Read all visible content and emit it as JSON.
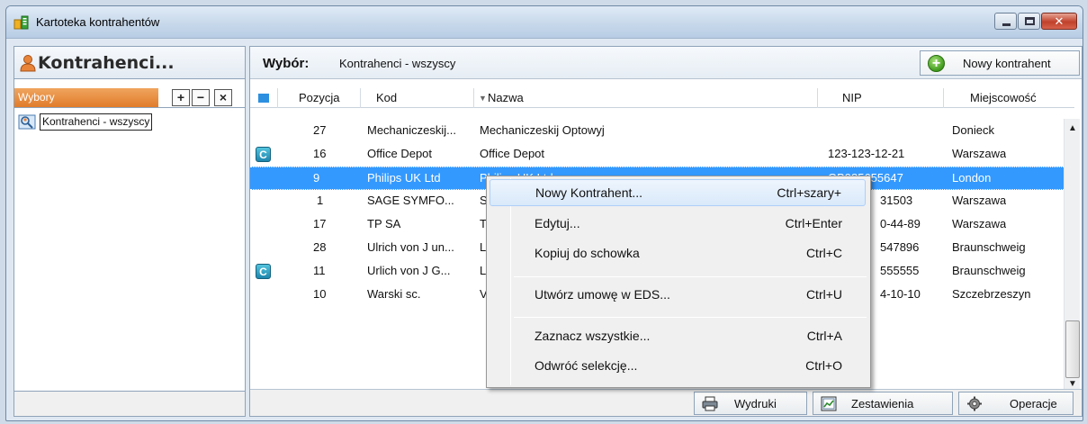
{
  "window": {
    "title": "Kartoteka kontrahentów"
  },
  "left_panel": {
    "title": "Kontrahenci...",
    "selections_label": "Wybory",
    "add_label": "+",
    "remove_label": "−",
    "close_label": "×",
    "tree_items": [
      {
        "label": "Kontrahenci - wszyscy"
      }
    ]
  },
  "right_panel": {
    "selection_label": "Wybór:",
    "selection_value": "Kontrahenci - wszyscy",
    "new_button_label": "Nowy kontrahent",
    "columns": {
      "pozycja": "Pozycja",
      "kod": "Kod",
      "nazwa": "Nazwa",
      "nazwa_sort": "▼",
      "nip": "NIP",
      "miejscowosc": "Miejscowość"
    },
    "rows": [
      {
        "icon": "",
        "pozycja": "27",
        "kod": "Mechaniczeskij...",
        "nazwa": "Mechaniczeskij Optowyj",
        "nip": "",
        "miejscowosc": "Donieck"
      },
      {
        "icon": "C",
        "pozycja": "16",
        "kod": "Office Depot",
        "nazwa": "Office Depot",
        "nip": "123-123-12-21",
        "miejscowosc": "Warszawa"
      },
      {
        "icon": "",
        "pozycja": "9",
        "kod": "Philips UK Ltd",
        "nazwa": "Philips UK Ltd",
        "nip": "GB985655647",
        "miejscowosc": "London"
      },
      {
        "icon": "",
        "pozycja": "1",
        "kod": "SAGE SYMFO...",
        "nazwa": "S",
        "nip": "31503",
        "miejscowosc": "Warszawa"
      },
      {
        "icon": "",
        "pozycja": "17",
        "kod": "TP SA",
        "nazwa": "T",
        "nip": "0-44-89",
        "miejscowosc": "Warszawa"
      },
      {
        "icon": "",
        "pozycja": "28",
        "kod": "Ulrich von J un...",
        "nazwa": "L",
        "nip": "547896",
        "miejscowosc": "Braunschweig"
      },
      {
        "icon": "C",
        "pozycja": "11",
        "kod": "Urlich von J G...",
        "nazwa": "L",
        "nip": "555555",
        "miejscowosc": "Braunschweig"
      },
      {
        "icon": "",
        "pozycja": "10",
        "kod": "Warski sc.",
        "nazwa": "V",
        "nip": "4-10-10",
        "miejscowosc": "Szczebrzeszyn"
      }
    ],
    "bottom_buttons": {
      "print": "Wydruki",
      "reports": "Zestawienia",
      "operations": "Operacje"
    }
  },
  "context_menu": {
    "items": [
      {
        "label": "Nowy Kontrahent...",
        "shortcut": "Ctrl+szary+"
      },
      {
        "label": "Edytuj...",
        "shortcut": "Ctrl+Enter"
      },
      {
        "label": "Kopiuj do schowka",
        "shortcut": "Ctrl+C"
      },
      {
        "label": "Utwórz umowę w EDS...",
        "shortcut": "Ctrl+U"
      },
      {
        "label": "Zaznacz wszystkie...",
        "shortcut": "Ctrl+A"
      },
      {
        "label": "Odwróć selekcję...",
        "shortcut": "Ctrl+O"
      }
    ]
  },
  "colors": {
    "selection": "#3399ff",
    "selections_tab": "#e07b2a",
    "badge": "#1e86ad",
    "add_icon": "#3f9b1d"
  },
  "icons": {
    "app": "folder-list-icon",
    "contacts": "user-icon",
    "tree_item": "search-people-icon",
    "add": "plus-circle-icon",
    "print": "printer-icon",
    "reports": "chart-icon",
    "operations": "gear-icon",
    "row_badge": "c-badge-icon"
  }
}
